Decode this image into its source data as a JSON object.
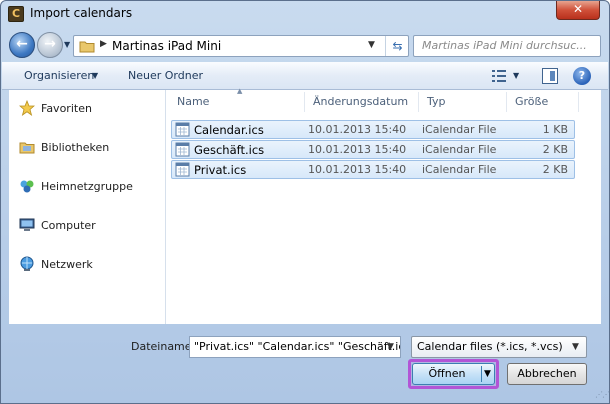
{
  "window": {
    "title": "Import calendars",
    "app_icon_glyph": "C",
    "close_glyph": "✕"
  },
  "navigation": {
    "address_path": "Martinas iPad Mini",
    "search_placeholder": "Martinas iPad Mini durchsuc..."
  },
  "toolbar": {
    "organize_label": "Organisieren",
    "new_folder_label": "Neuer Ordner",
    "help_glyph": "?"
  },
  "sidebar": {
    "items": [
      {
        "label": "Favoriten",
        "icon": "star-icon"
      },
      {
        "label": "Bibliotheken",
        "icon": "library-icon"
      },
      {
        "label": "Heimnetzgruppe",
        "icon": "homegroup-icon"
      },
      {
        "label": "Computer",
        "icon": "computer-icon"
      },
      {
        "label": "Netzwerk",
        "icon": "network-icon"
      }
    ]
  },
  "columns": {
    "name": "Name",
    "date": "Änderungsdatum",
    "type": "Typ",
    "size": "Größe"
  },
  "files": [
    {
      "name": "Calendar.ics",
      "date": "10.01.2013 15:40",
      "type": "iCalendar File",
      "size": "1 KB"
    },
    {
      "name": "Geschäft.ics",
      "date": "10.01.2013 15:40",
      "type": "iCalendar File",
      "size": "2 KB"
    },
    {
      "name": "Privat.ics",
      "date": "10.01.2013 15:40",
      "type": "iCalendar File",
      "size": "2 KB"
    }
  ],
  "footer": {
    "filename_label": "Dateiname:",
    "filename_value": "\"Privat.ics\" \"Calendar.ics\" \"Geschäft.ics\"",
    "filetype_value": "Calendar files (*.ics, *.vcs)",
    "open_label": "Öffnen",
    "cancel_label": "Abbrechen"
  },
  "colors": {
    "selection_fill": "#d7e8fa",
    "selection_border": "#9ec0e6",
    "highlight": "#b255d6"
  }
}
